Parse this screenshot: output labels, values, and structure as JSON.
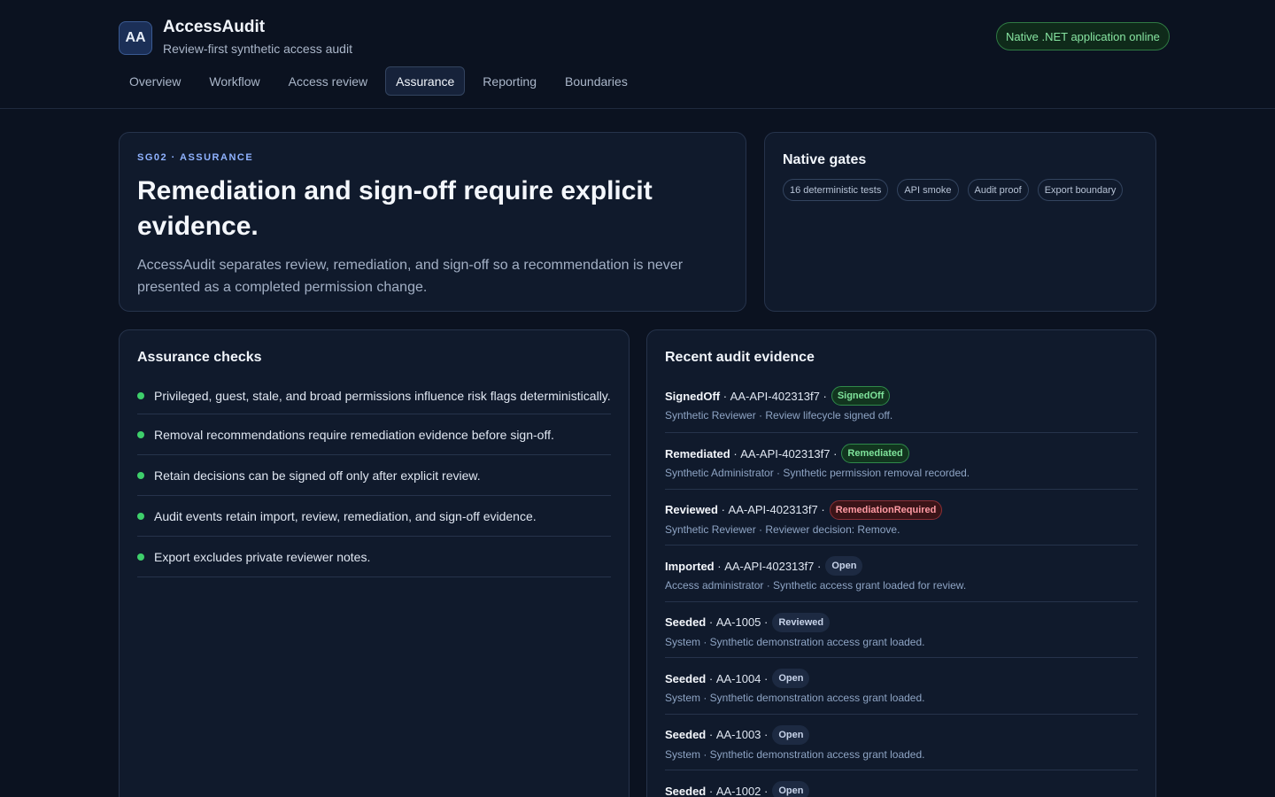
{
  "app": {
    "logo_text": "AA",
    "title": "AccessAudit",
    "subtitle": "Review-first synthetic access audit",
    "status": "Native .NET application online"
  },
  "nav": {
    "tabs": [
      {
        "label": "Overview",
        "active": false
      },
      {
        "label": "Workflow",
        "active": false
      },
      {
        "label": "Access review",
        "active": false
      },
      {
        "label": "Assurance",
        "active": true
      },
      {
        "label": "Reporting",
        "active": false
      },
      {
        "label": "Boundaries",
        "active": false
      }
    ]
  },
  "hero": {
    "eyebrow": "SG02 · ASSURANCE",
    "title": "Remediation and sign-off require explicit evidence.",
    "description": "AccessAudit separates review, remediation, and sign-off so a recommendation is never presented as a completed permission change."
  },
  "gates": {
    "title": "Native gates",
    "chips": [
      "16 deterministic tests",
      "API smoke",
      "Audit proof",
      "Export boundary"
    ]
  },
  "checks": {
    "title": "Assurance checks",
    "items": [
      "Privileged, guest, stale, and broad permissions influence risk flags deterministically.",
      "Removal recommendations require remediation evidence before sign-off.",
      "Retain decisions can be signed off only after explicit review.",
      "Audit events retain import, review, remediation, and sign-off evidence.",
      "Export excludes private reviewer notes."
    ],
    "status_color": "#3ecf6b"
  },
  "evidence": {
    "title": "Recent audit evidence",
    "items": [
      {
        "event": "SignedOff",
        "id": "AA-API-402313f7",
        "badge": "SignedOff",
        "tone": "green",
        "detail": "Synthetic Reviewer · Review lifecycle signed off."
      },
      {
        "event": "Remediated",
        "id": "AA-API-402313f7",
        "badge": "Remediated",
        "tone": "green",
        "detail": "Synthetic Administrator · Synthetic permission removal recorded."
      },
      {
        "event": "Reviewed",
        "id": "AA-API-402313f7",
        "badge": "RemediationRequired",
        "tone": "red",
        "detail": "Synthetic Reviewer · Reviewer decision: Remove."
      },
      {
        "event": "Imported",
        "id": "AA-API-402313f7",
        "badge": "Open",
        "tone": "neutral",
        "detail": "Access administrator · Synthetic access grant loaded for review."
      },
      {
        "event": "Seeded",
        "id": "AA-1005",
        "badge": "Reviewed",
        "tone": "neutral",
        "detail": "System · Synthetic demonstration access grant loaded."
      },
      {
        "event": "Seeded",
        "id": "AA-1004",
        "badge": "Open",
        "tone": "neutral",
        "detail": "System · Synthetic demonstration access grant loaded."
      },
      {
        "event": "Seeded",
        "id": "AA-1003",
        "badge": "Open",
        "tone": "neutral",
        "detail": "System · Synthetic demonstration access grant loaded."
      },
      {
        "event": "Seeded",
        "id": "AA-1002",
        "badge": "Open",
        "tone": "neutral",
        "detail": ""
      }
    ]
  }
}
